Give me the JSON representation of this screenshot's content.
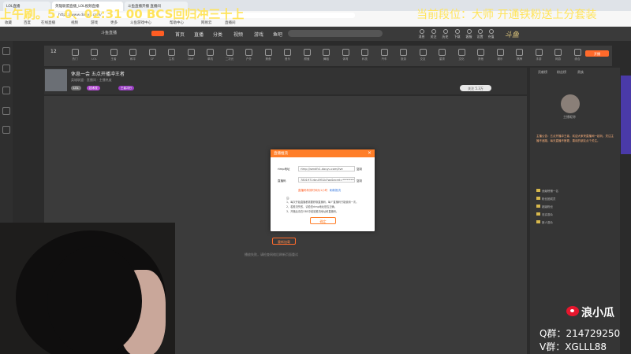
{
  "browser": {
    "tabs": [
      {
        "label": "LOL直播",
        "active": false
      },
      {
        "label": "英雄联盟直播_LOL视频直播",
        "active": true
      },
      {
        "label": "斗鱼直播开播 直播间",
        "active": false
      }
    ],
    "url": "https://www.douyu.com/",
    "bookmarks": [
      "收藏",
      "百度",
      "在线直播",
      "视频",
      "游戏",
      "更多",
      "斗鱼游戏中心",
      "帮助中心",
      "网易云",
      "直播间"
    ]
  },
  "header": {
    "logo_text": "斗鱼直播",
    "nav": [
      "首页",
      "直播",
      "分类",
      "视频",
      "游戏",
      "鱼吧",
      "赛事",
      "FM"
    ],
    "icons": [
      "消息",
      "关注",
      "历史",
      "下载",
      "客服",
      "设置",
      "充值"
    ],
    "banner": "斗鱼"
  },
  "categories": {
    "count_label": "12",
    "items": [
      "热门",
      "LOL",
      "王者",
      "和平",
      "CF",
      "主机",
      "DNF",
      "单机",
      "二次元",
      "户外",
      "美食",
      "音乐",
      "颜值",
      "舞蹈",
      "体育",
      "科技",
      "汽车",
      "旅游",
      "交友",
      "星秀",
      "文化",
      "其他",
      "娱乐",
      "棋牌",
      "手游",
      "网游",
      "综合"
    ],
    "action": "开播"
  },
  "room": {
    "title": "休息一会 五点开播冲王者",
    "subtitle": "英雄联盟 · 直播间 · 主播热度",
    "tags": [
      "LOL",
      "技术流",
      "王者冲分"
    ],
    "follow_label": "关注 5.3万"
  },
  "player": {
    "retry_label": "重新加载",
    "error_text": "播放失败，请检查网络后刷新页面重试"
  },
  "modal": {
    "title": "直播推流",
    "rtmp_label": "rtmp地址",
    "rtmp_value": "rtmp://sendfc1.douyu.com/live",
    "key_label": "直播码",
    "key_value": "7801971rbn4951b?wsSecret=*********",
    "copy_label": "复制",
    "hint": "直播码有效时间为1小时",
    "hint_link": "刷新推流",
    "notes": [
      "注：",
      "1、每次开始直播都需要获取直播码，每个直播码只能使用一次。",
      "2、若推流失败，请检查rtmp地址是否正确。",
      "3、开播后请在OBS中粘贴推流地址和直播码。"
    ],
    "confirm_label": "确定"
  },
  "right_panel": {
    "tabs": [
      "贡献榜",
      "粉丝榜",
      "贵族"
    ],
    "anchor_name": "主播昵称",
    "bulletin": "主播公告：五点开播冲王者，欢迎大家来直播间一起玩，关注主播不迷路，每天直播不断更，喜欢的朋友点个关注。",
    "ranks": [
      "贡献榜第一名",
      "粉丝团成员",
      "超级粉丝",
      "忠实观众",
      "新人观众"
    ]
  },
  "overlay": {
    "left": "上午刷。5. 0、02:31 00 BCS回归冲三十上",
    "right": "当前段位：大师 开通铁粉送上分套装",
    "weibo": "浪小瓜",
    "qq": "Q群：214729250",
    "v": "V群：XGLLL88"
  },
  "colors": {
    "accent": "#ff7e28",
    "overlay_text": "#ffe45c",
    "weibo": "#e6162d"
  }
}
